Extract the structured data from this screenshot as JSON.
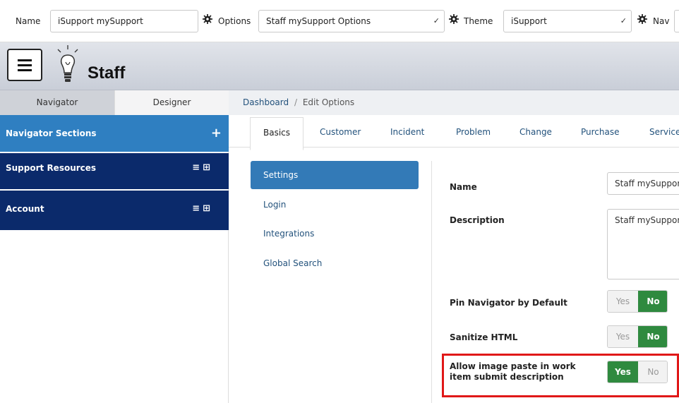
{
  "toolbar": {
    "name_label": "Name",
    "name_value": "iSupport mySupport",
    "options_label": "Options",
    "options_value": "Staff mySupport Options",
    "theme_label": "Theme",
    "theme_value": "iSupport",
    "nav_label": "Nav"
  },
  "header": {
    "brand": "Staff"
  },
  "left_panel": {
    "tabs": [
      "Navigator",
      "Designer"
    ],
    "sections": [
      {
        "label": "Navigator Sections",
        "color": "#2f7fc1"
      },
      {
        "label": "Support Resources",
        "color": "#0b2a6b"
      },
      {
        "label": "Account",
        "color": "#0b2a6b"
      }
    ]
  },
  "breadcrumb": {
    "home": "Dashboard",
    "separator": "/",
    "current": "Edit Options"
  },
  "tabs": [
    "Basics",
    "Customer",
    "Incident",
    "Problem",
    "Change",
    "Purchase",
    "Service"
  ],
  "sub_nav": [
    "Settings",
    "Login",
    "Integrations",
    "Global Search"
  ],
  "form": {
    "name_label": "Name",
    "name_value": "Staff mySupport",
    "description_label": "Description",
    "description_value": "Staff mySupport",
    "pin_label": "Pin Navigator by Default",
    "sanitize_label": "Sanitize HTML",
    "paste_label_line1": "Allow image paste in work",
    "paste_label_line2": "item submit description",
    "yes": "Yes",
    "no": "No"
  },
  "colors": {
    "accent": "#337ab7",
    "toggle_on": "#2f8a3f",
    "highlight": "#e01818"
  }
}
